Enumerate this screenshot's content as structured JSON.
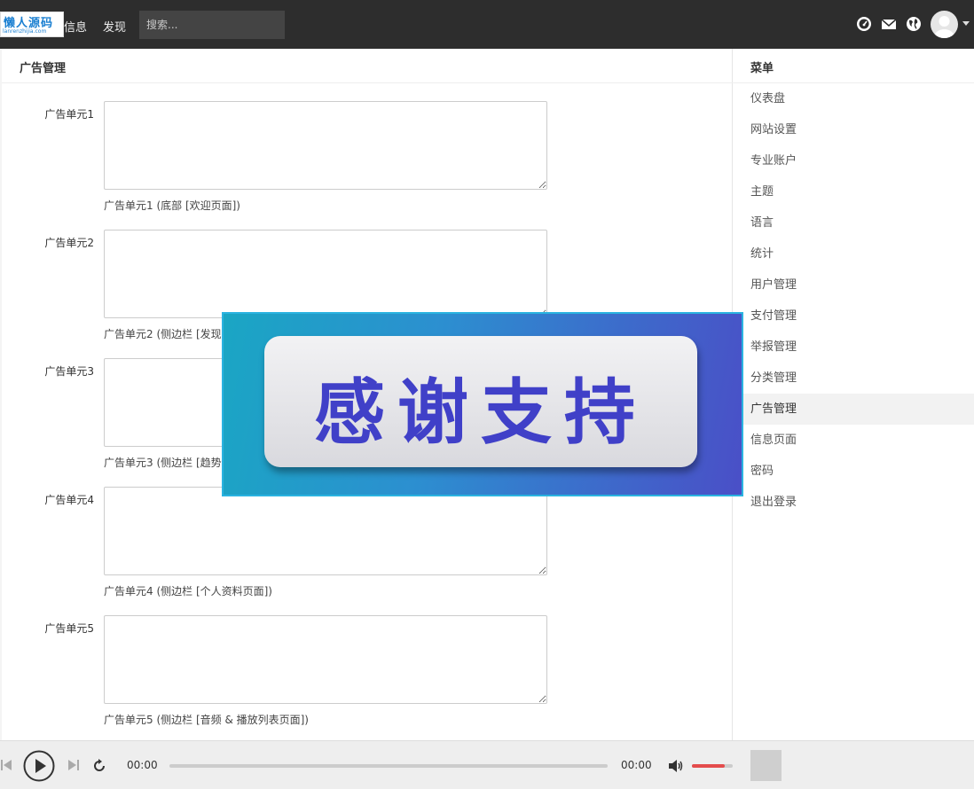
{
  "topbar": {
    "logo_text": "懒人源码",
    "logo_sub": "lanrenzhijia.com",
    "nav": [
      {
        "label": "信息"
      },
      {
        "label": "发现"
      }
    ],
    "search_placeholder": "搜索..."
  },
  "main": {
    "title": "广告管理",
    "ad_units": [
      {
        "label": "广告单元1",
        "value": "",
        "help": "广告单元1 (底部 [欢迎页面])"
      },
      {
        "label": "广告单元2",
        "value": "",
        "help": "广告单元2 (侧边栏 [发现页面])"
      },
      {
        "label": "广告单元3",
        "value": "",
        "help": "广告单元3 (侧边栏 [趋势页面])"
      },
      {
        "label": "广告单元4",
        "value": "",
        "help": "广告单元4 (侧边栏 [个人资料页面])"
      },
      {
        "label": "广告单元5",
        "value": "",
        "help": "广告单元5 (侧边栏 [音频 & 播放列表页面])"
      }
    ]
  },
  "sidebar": {
    "title": "菜单",
    "items": [
      {
        "label": "仪表盘"
      },
      {
        "label": "网站设置"
      },
      {
        "label": "专业账户"
      },
      {
        "label": "主题"
      },
      {
        "label": "语言"
      },
      {
        "label": "统计"
      },
      {
        "label": "用户管理"
      },
      {
        "label": "支付管理"
      },
      {
        "label": "举报管理"
      },
      {
        "label": "分类管理"
      },
      {
        "label": "广告管理"
      },
      {
        "label": "信息页面"
      },
      {
        "label": "密码"
      },
      {
        "label": "退出登录"
      }
    ],
    "active_index": 10
  },
  "banner": {
    "text": "感谢支持"
  },
  "player": {
    "current_time": "00:00",
    "total_time": "00:00",
    "progress": 0,
    "volume": 0.8,
    "accent_color": "#e44c4c"
  }
}
